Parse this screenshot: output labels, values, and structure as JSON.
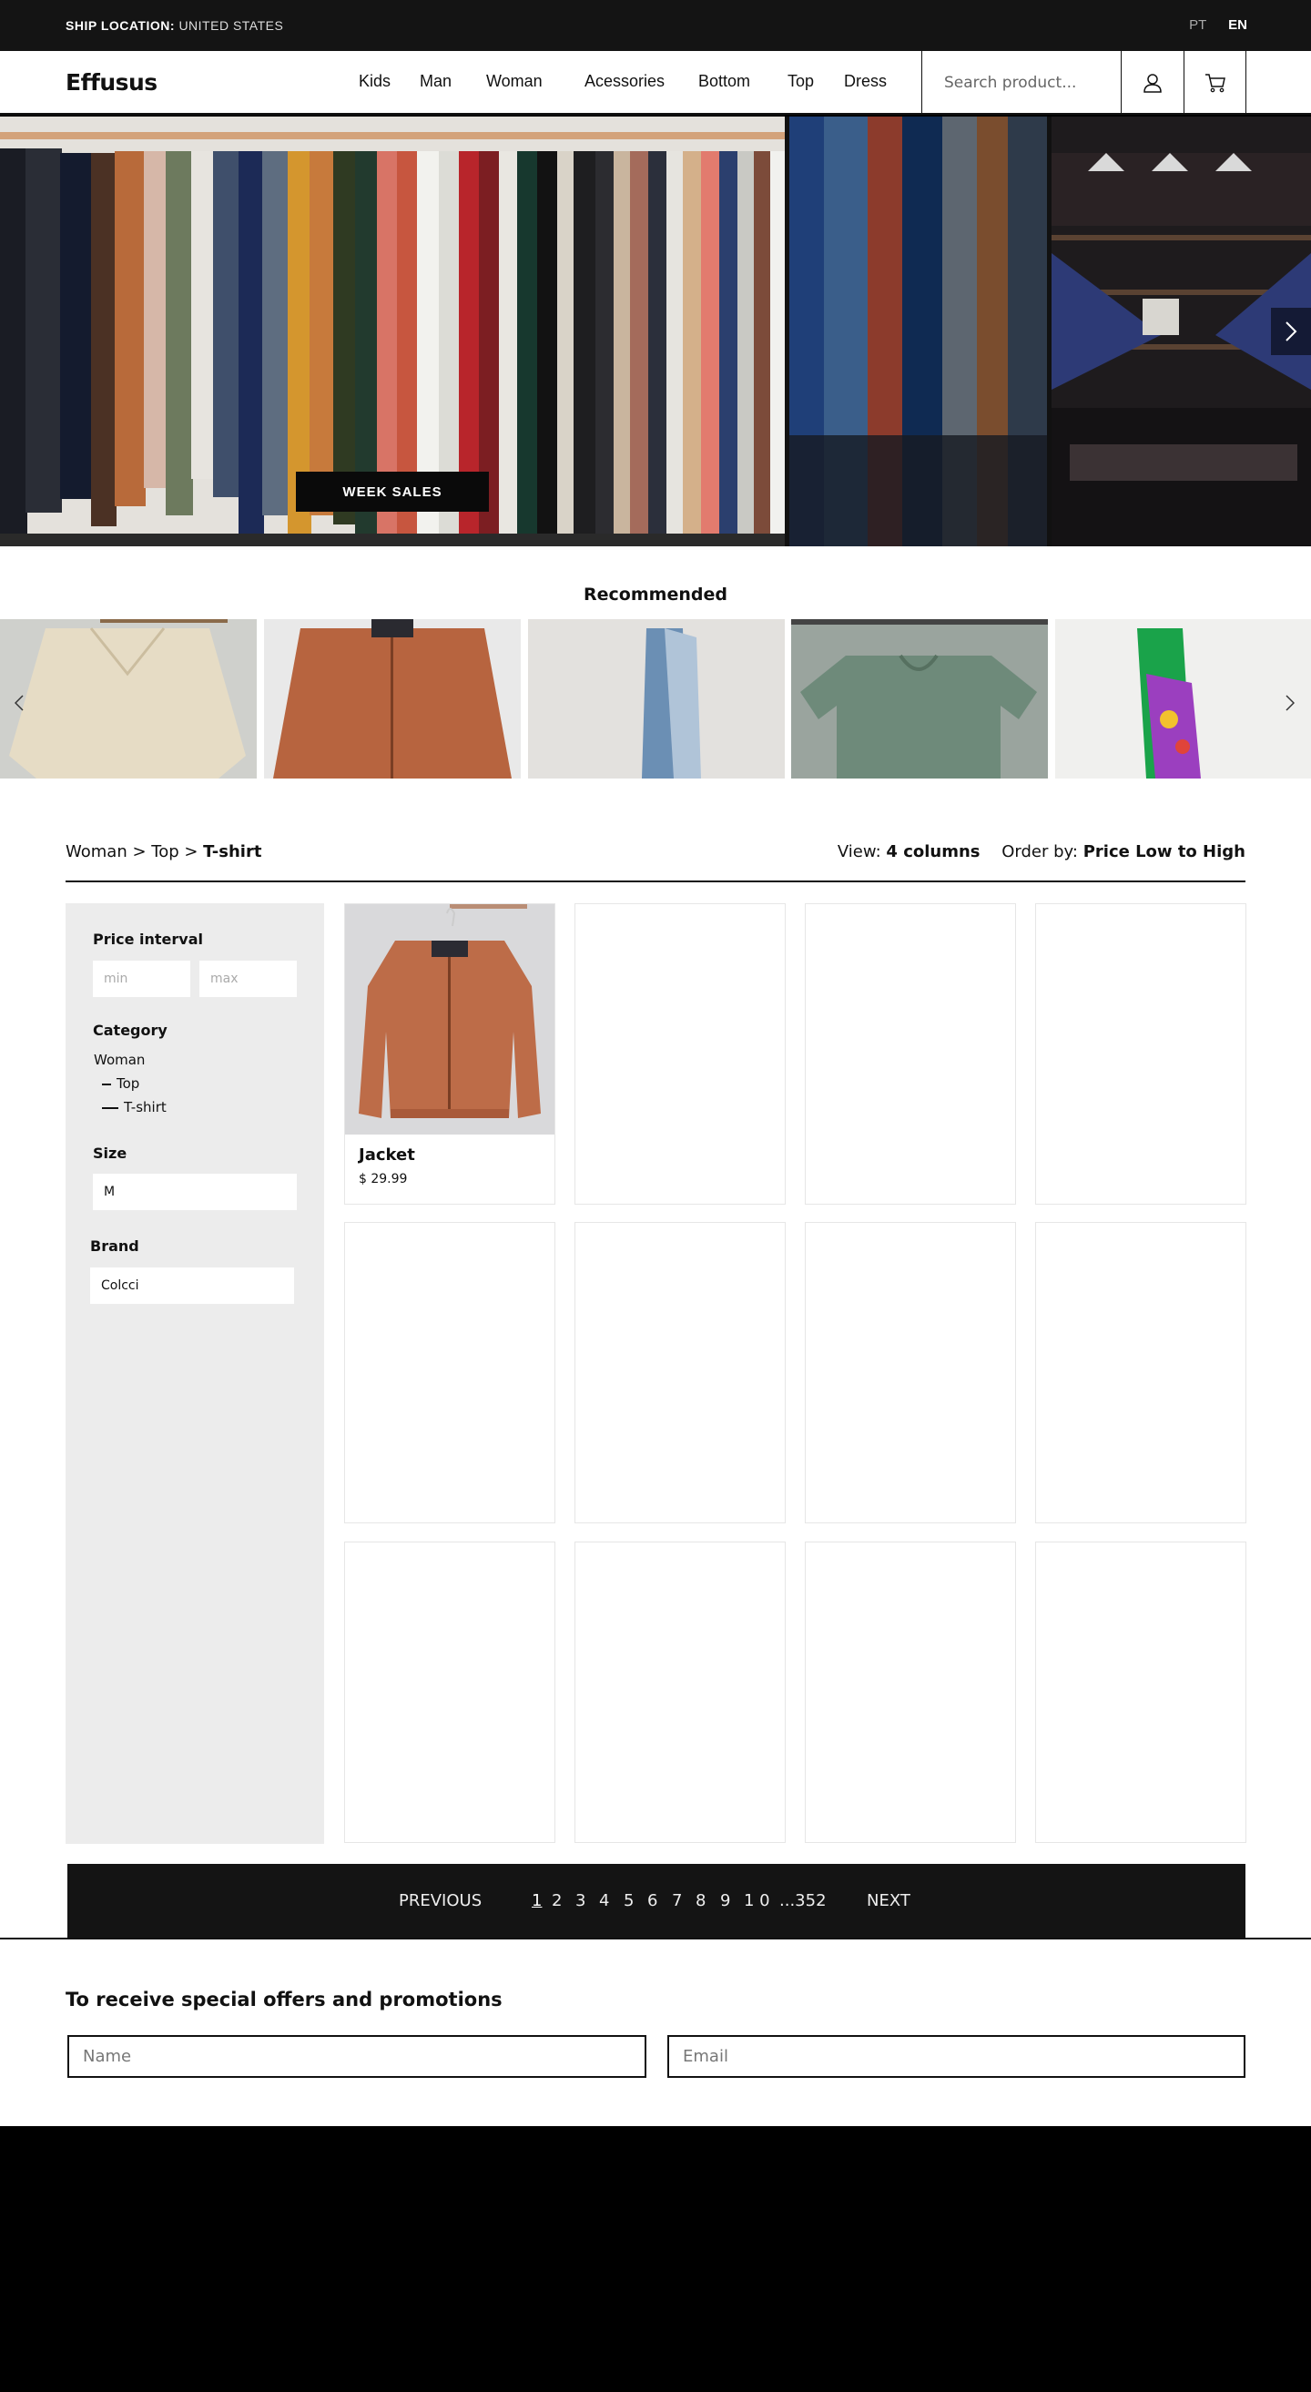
{
  "topbar": {
    "ship_label": "SHIP LOCATION:",
    "ship_value": "UNITED STATES",
    "langs": [
      "PT",
      "EN"
    ],
    "active_lang": "EN"
  },
  "header": {
    "logo": "Effusus",
    "nav": [
      "Kids",
      "Man",
      "Woman",
      "Acessories",
      "Bottom",
      "Top",
      "Dress"
    ],
    "search_placeholder": "Search product...",
    "icons": [
      "user-icon",
      "cart-icon"
    ]
  },
  "hero": {
    "cta": "WEEK SALES",
    "next_icon": "chevron-right-icon"
  },
  "recommended": {
    "title": "Recommended",
    "items": [
      "knit sweater",
      "orange jacket",
      "denim jacket",
      "green t-shirts",
      "colorful print shirt"
    ],
    "prev_icon": "chevron-left-icon",
    "next_icon": "chevron-right-icon"
  },
  "catalog": {
    "breadcrumb": {
      "a": "Woman",
      "b": "Top",
      "current": "T-shirt",
      "sep": " > "
    },
    "view_label": "View:",
    "view_value": "4 columns",
    "order_label": "Order by:",
    "order_value": "Price Low to High"
  },
  "filters": {
    "price_title": "Price interval",
    "min_placeholder": "min",
    "max_placeholder": "max",
    "category_title": "Category",
    "categories": [
      "Woman",
      "Top",
      "T-shirt"
    ],
    "size_title": "Size",
    "size_value": "M",
    "brand_title": "Brand",
    "brand_value": "Colcci"
  },
  "products": [
    {
      "name": "Jacket",
      "price": "$ 29.99"
    }
  ],
  "pagination": {
    "prev": "PREVIOUS",
    "next": "NEXT",
    "pages": [
      "1",
      "2",
      "3",
      "4",
      "5",
      "6",
      "7",
      "8",
      "9",
      "1 0",
      "...352"
    ],
    "current": "1"
  },
  "newsletter": {
    "title": "To receive special offers and promotions",
    "name_placeholder": "Name",
    "email_placeholder": "Email"
  },
  "colors": {
    "dark": "#141414",
    "panel": "#ececec",
    "accent_jacket": "#c06a46"
  }
}
